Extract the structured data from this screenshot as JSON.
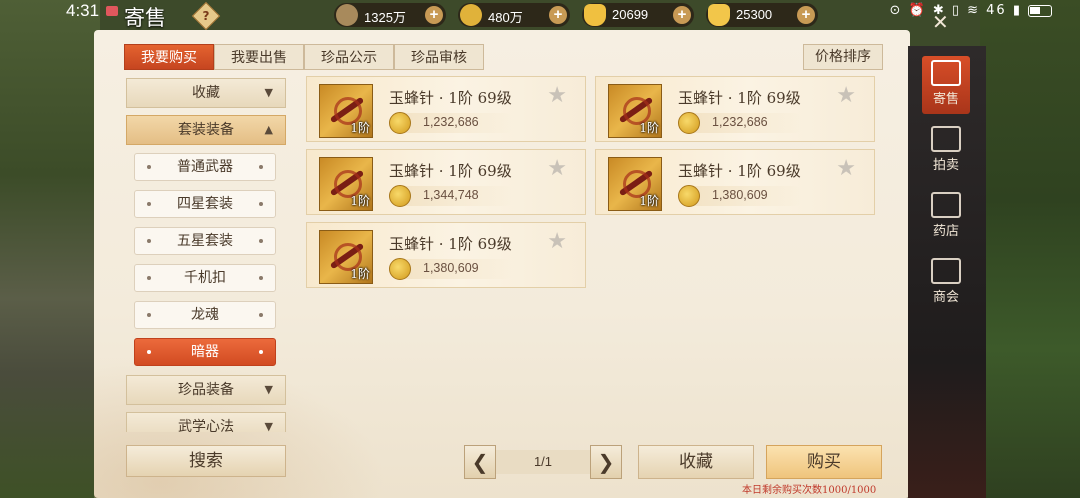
{
  "status_bar": {
    "time": "4:31",
    "right_icons": "⊙ ⏰ ✱ ▯ ≋ 46 ▮"
  },
  "window": {
    "title": "寄售"
  },
  "currency": [
    {
      "value": "1325万",
      "color": "#a88a5c",
      "icon": "coin-bag-icon"
    },
    {
      "value": "480万",
      "color": "#e0b23a",
      "icon": "gold-coin-icon"
    },
    {
      "value": "20699",
      "color": "#f0c040",
      "icon": "gold-ingot-icon"
    },
    {
      "value": "25300",
      "color": "#f2c64a",
      "icon": "gold-ingot-icon"
    }
  ],
  "tabs": [
    {
      "label": "我要购买",
      "active": true
    },
    {
      "label": "我要出售",
      "active": false
    },
    {
      "label": "珍品公示",
      "active": false
    },
    {
      "label": "珍品审核",
      "active": false
    }
  ],
  "sort_label": "价格排序",
  "sidebar": {
    "categories": [
      {
        "label": "收藏",
        "arrow": "▼"
      },
      {
        "label": "套装装备",
        "arrow": "▲"
      },
      {
        "label": "珍品装备",
        "arrow": "▼"
      },
      {
        "label": "武学心法",
        "arrow": "▼"
      }
    ],
    "subitems": [
      {
        "label": "普通武器"
      },
      {
        "label": "四星套装"
      },
      {
        "label": "五星套装"
      },
      {
        "label": "千机扣"
      },
      {
        "label": "龙魂"
      },
      {
        "label": "暗器"
      }
    ]
  },
  "search_label": "搜索",
  "items": [
    {
      "name": "玉蜂针 · 1阶 69级",
      "tier": "1阶",
      "price": "1,232,686"
    },
    {
      "name": "玉蜂针 · 1阶 69级",
      "tier": "1阶",
      "price": "1,232,686"
    },
    {
      "name": "玉蜂针 · 1阶 69级",
      "tier": "1阶",
      "price": "1,344,748"
    },
    {
      "name": "玉蜂针 · 1阶 69级",
      "tier": "1阶",
      "price": "1,380,609"
    },
    {
      "name": "玉蜂针 · 1阶 69级",
      "tier": "1阶",
      "price": "1,380,609"
    }
  ],
  "pager": {
    "prev": "❮",
    "next": "❯",
    "text": "1/1"
  },
  "favorite_label": "收藏",
  "buy_label": "购买",
  "daily_remaining": "本日剩余购买次数1000/1000",
  "right_nav": [
    {
      "label": "寄售",
      "active": true
    },
    {
      "label": "拍卖",
      "active": false
    },
    {
      "label": "药店",
      "active": false
    },
    {
      "label": "商会",
      "active": false
    }
  ],
  "colors": {
    "accent": "#d24b22",
    "panel": "#f6efe2",
    "buy": "#efc47c"
  }
}
